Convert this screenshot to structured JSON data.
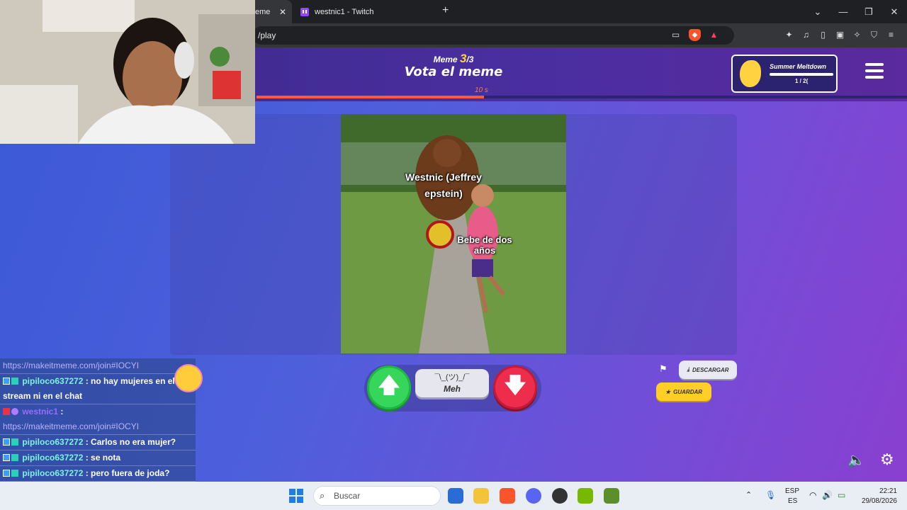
{
  "browser": {
    "tabs": [
      {
        "label": "eme",
        "active": true
      },
      {
        "label": "westnic1 - Twitch",
        "active": false
      }
    ],
    "url": "/play",
    "colors": {
      "tabbar": "#1f2023",
      "toolbar": "#35363a"
    }
  },
  "game": {
    "meme_prefix": "Meme",
    "meme_current": "3",
    "meme_total": "/3",
    "title": "Vota el meme",
    "timer": "10 s",
    "timer_progress_fraction": 0.35,
    "event": {
      "title": "Summer Meltdown",
      "count": "1 / 2("
    },
    "captions": [
      "Westnic (Jeffrey epstein)",
      "Bebe de dos años"
    ],
    "meh_face": "¯\\_(ツ)_/¯",
    "meh_label": "Meh",
    "download_label": "DESCARGAR",
    "save_label": "GUARDAR",
    "colors": {
      "accent_up": "#35d65a",
      "accent_down": "#ee2c4c",
      "save": "#ffcf28",
      "timer": "#ff5a36"
    }
  },
  "chat": {
    "messages": [
      {
        "user": "",
        "text": "https://makeitmeme.com/join#IOCYI",
        "link": true
      },
      {
        "user": "pipiloco637272",
        "text": " : no hay mujeres en el stream ni en el chat"
      },
      {
        "user": "westnic1",
        "text": " :",
        "link_text": "https://makeitmeme.com/join#IOCYI"
      },
      {
        "user": "pipiloco637272",
        "text": " : Carlos no era mujer?"
      },
      {
        "user": "pipiloco637272",
        "text": " : se nota"
      },
      {
        "user": "pipiloco637272",
        "text": " : pero fuera de joda?"
      }
    ]
  },
  "taskbar": {
    "search_placeholder": "Buscar",
    "lang_top": "ESP",
    "lang_bottom": "ES",
    "time": "22:21",
    "date": "29/08/2026"
  }
}
